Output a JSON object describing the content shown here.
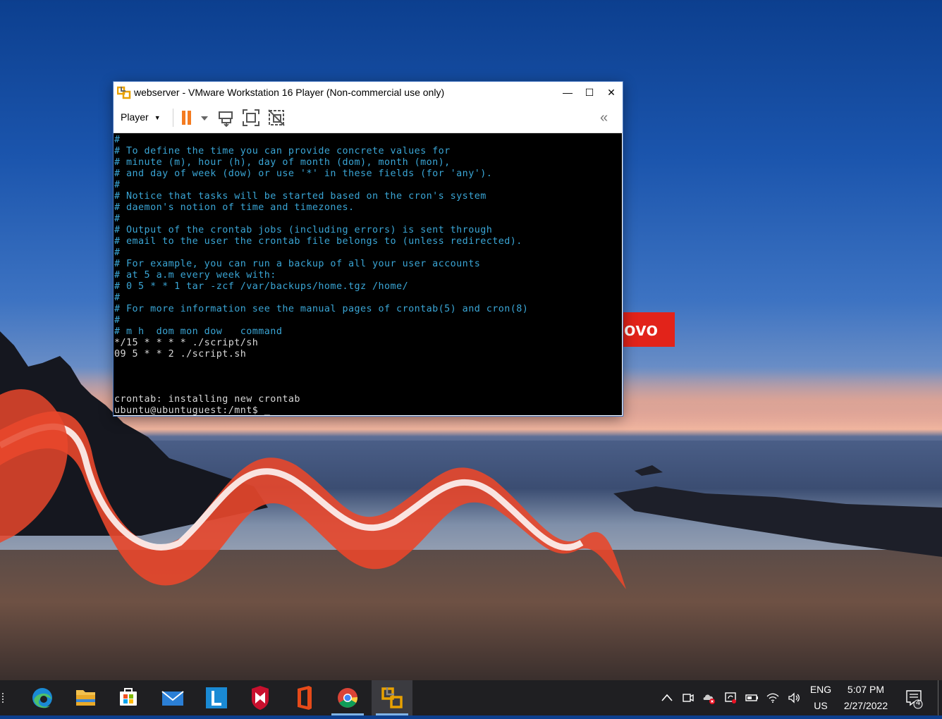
{
  "window": {
    "title": "webserver - VMware Workstation 16 Player (Non-commercial use only)",
    "minimize": "—",
    "maximize": "☐",
    "close": "✕"
  },
  "toolbar": {
    "player_menu": "Player",
    "collapse": "«"
  },
  "terminal": {
    "lines": [
      "#",
      "# To define the time you can provide concrete values for",
      "# minute (m), hour (h), day of month (dom), month (mon),",
      "# and day of week (dow) or use '*' in these fields (for 'any').",
      "#",
      "# Notice that tasks will be started based on the cron's system",
      "# daemon's notion of time and timezones.",
      "#",
      "# Output of the crontab jobs (including errors) is sent through",
      "# email to the user the crontab file belongs to (unless redirected).",
      "#",
      "# For example, you can run a backup of all your user accounts",
      "# at 5 a.m every week with:",
      "# 0 5 * * 1 tar -zcf /var/backups/home.tgz /home/",
      "#",
      "# For more information see the manual pages of crontab(5) and cron(8)",
      "#",
      "# m h  dom mon dow   command",
      "*/15 * * * * ./script/sh",
      "09 5 * * 2 ./script.sh",
      "",
      "",
      "",
      "crontab: installing new crontab",
      "ubuntu@ubuntuguest:/mnt$ _"
    ]
  },
  "wallpaper": {
    "logo_text": "ovo"
  },
  "taskbar": {
    "apps": [
      "edge-icon",
      "file-explorer-icon",
      "store-icon",
      "mail-icon",
      "l-app-icon",
      "mcafee-icon",
      "office-icon",
      "chrome-icon",
      "vmware-icon"
    ],
    "lang_top": "ENG",
    "lang_bottom": "US",
    "time": "5:07 PM",
    "date": "2/27/2022",
    "notifications": "4"
  },
  "colors": {
    "terminal_comment": "#3aa6d6",
    "terminal_text": "#d8d8d8",
    "pause": "#f47b20",
    "taskbar": "#1f1f22"
  }
}
